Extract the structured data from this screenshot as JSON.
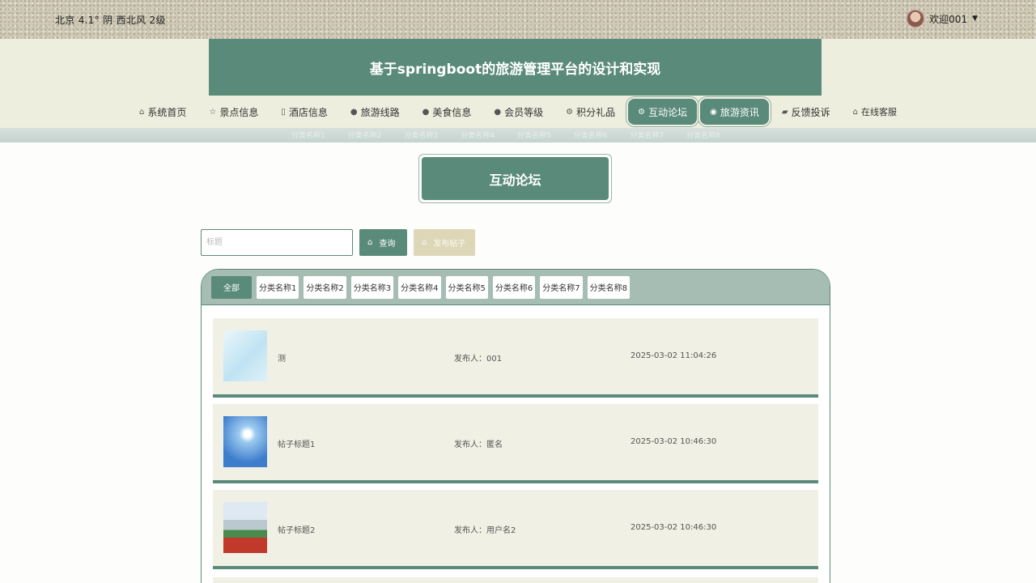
{
  "topbar": {
    "weather": "北京  4.1°  阴  西北风  2级",
    "welcome": "欢迎001"
  },
  "header": {
    "site_title": "基于springboot的旅游管理平台的设计和实现"
  },
  "nav": {
    "items": [
      {
        "label": "系统首页",
        "icon": "home-icon"
      },
      {
        "label": "景点信息",
        "icon": "star-icon"
      },
      {
        "label": "酒店信息",
        "icon": "building-icon"
      },
      {
        "label": "旅游线路",
        "icon": "info-circle-icon"
      },
      {
        "label": "美食信息",
        "icon": "question-circle-icon"
      },
      {
        "label": "会员等级",
        "icon": "info-circle-icon"
      },
      {
        "label": "积分礼品",
        "icon": "settings-icon"
      },
      {
        "label": "互动论坛",
        "icon": "settings-icon"
      },
      {
        "label": "旅游资讯",
        "icon": "camera-icon"
      },
      {
        "label": "反馈投诉",
        "icon": "car-icon"
      },
      {
        "label": "在线客服",
        "icon": "home-icon"
      }
    ],
    "active_index": 7,
    "hover_index": 8
  },
  "sub_nav": [
    "分类名称1",
    "分类名称2",
    "分类名称3",
    "分类名称4",
    "分类名称5",
    "分类名称6",
    "分类名称7",
    "分类名称8"
  ],
  "page": {
    "title": "互动论坛"
  },
  "search": {
    "placeholder": "标题",
    "query_label": "查询",
    "post_label": "发布帖子"
  },
  "categories": {
    "items": [
      "全部",
      "分类名称1",
      "分类名称2",
      "分类名称3",
      "分类名称4",
      "分类名称5",
      "分类名称6",
      "分类名称7",
      "分类名称8"
    ],
    "active_index": 0
  },
  "posts": [
    {
      "title": "测",
      "author": "发布人：001",
      "date": "2025-03-02 11:04:26",
      "thumb": "water-drops-image"
    },
    {
      "title": "帖子标题1",
      "author": "发布人：匿名",
      "date": "2025-03-02 10:46:30",
      "thumb": "sky-clouds-image"
    },
    {
      "title": "帖子标题2",
      "author": "发布人：用户名2",
      "date": "2025-03-02 10:46:30",
      "thumb": "stadium-track-image"
    }
  ],
  "colors": {
    "primary": "#5a8a7a",
    "band": "#eeeedf",
    "card": "#f0f0e4",
    "post_button": "#ddd7b8"
  }
}
